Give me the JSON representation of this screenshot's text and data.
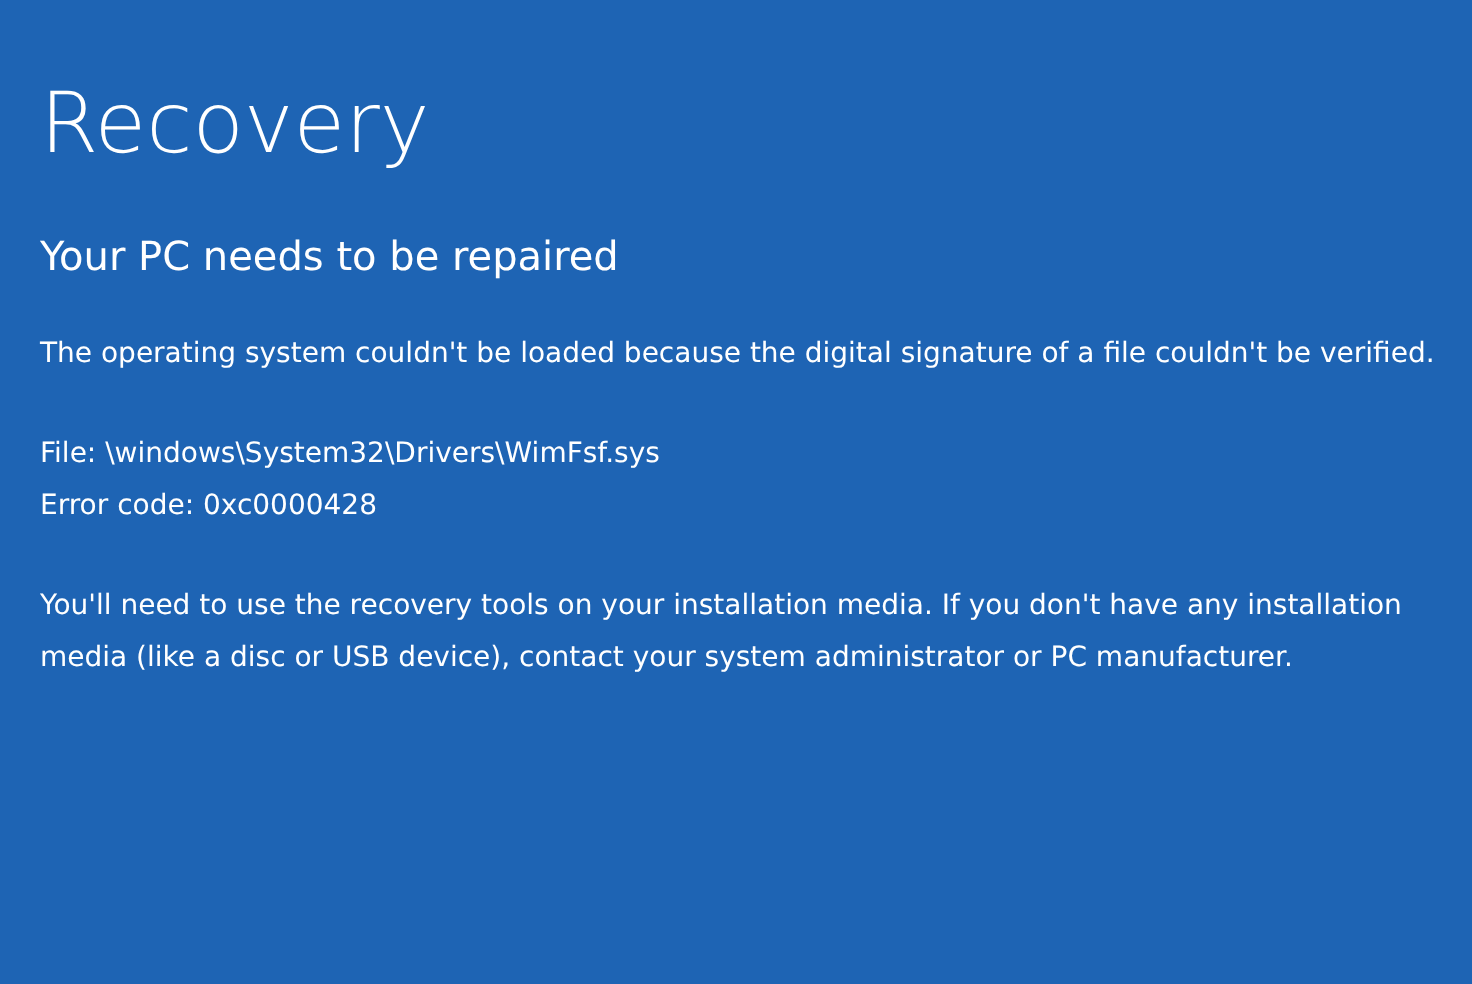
{
  "title": "Recovery",
  "subtitle": "Your PC needs to be repaired",
  "paragraphs": [
    {
      "lines": [
        "The operating system couldn't be loaded because the digital signature of a file couldn't be verified."
      ]
    },
    {
      "lines": [
        "File: \\windows\\System32\\Drivers\\WimFsf.sys",
        "Error code: 0xc0000428"
      ]
    },
    {
      "lines": [
        "You'll need to use the recovery tools on your installation media. If you don't have any installation media (like a disc or USB device), contact your system administrator or PC manufacturer."
      ]
    }
  ]
}
